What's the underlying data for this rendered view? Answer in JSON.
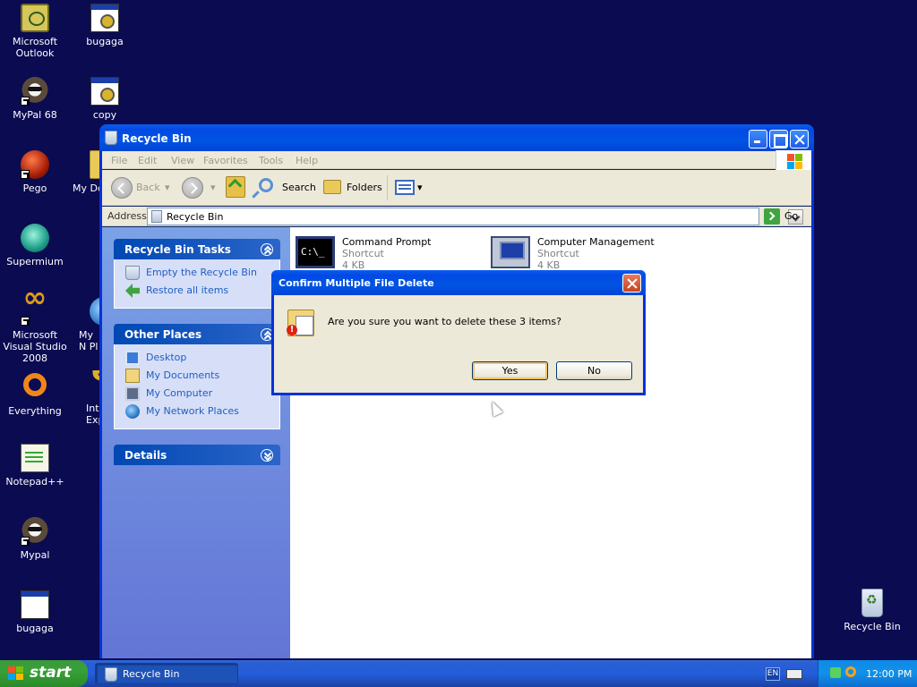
{
  "desktop": {
    "icons": [
      {
        "label": "Microsoft Outlook"
      },
      {
        "label": "bugaga"
      },
      {
        "label": "MyPal 68"
      },
      {
        "label": "copy"
      },
      {
        "label": "Pego"
      },
      {
        "label": "My Dc"
      },
      {
        "label": "Supermium"
      },
      {
        "label": "Microsoft Visual Studio 2008"
      },
      {
        "label": "My N Pl"
      },
      {
        "label": "Everything"
      },
      {
        "label": "Int Exp"
      },
      {
        "label": "Notepad++"
      },
      {
        "label": "Mypal"
      },
      {
        "label": "bugaga"
      },
      {
        "label": "Recycle Bin"
      }
    ]
  },
  "window": {
    "title": "Recycle Bin",
    "menu": [
      "File",
      "Edit",
      "View",
      "Favorites",
      "Tools",
      "Help"
    ],
    "toolbar": {
      "back": "Back",
      "search": "Search",
      "folders": "Folders"
    },
    "address": {
      "label": "Address",
      "value": "Recycle Bin",
      "go": "Go"
    },
    "tasks": {
      "title": "Recycle Bin Tasks",
      "items": [
        "Empty the Recycle Bin",
        "Restore all items"
      ]
    },
    "other_places": {
      "title": "Other Places",
      "items": [
        "Desktop",
        "My Documents",
        "My Computer",
        "My Network Places"
      ]
    },
    "details": {
      "title": "Details"
    },
    "files": [
      {
        "name": "Command Prompt",
        "type": "Shortcut",
        "size": "4 KB",
        "icon_text": "C:\\_"
      },
      {
        "name": "Computer Management",
        "type": "Shortcut",
        "size": "4 KB"
      }
    ]
  },
  "dialog": {
    "title": "Confirm Multiple File Delete",
    "message": "Are you sure you want to delete these 3 items?",
    "yes": "Yes",
    "no": "No"
  },
  "taskbar": {
    "start": "start",
    "task": "Recycle Bin",
    "lang": "EN",
    "clock": "12:00 PM"
  },
  "colors": {
    "desktop_bg": "#0b0b52",
    "xp_blue": "#0054e3",
    "start_green": "#37a137",
    "task_link": "#215dc6"
  }
}
